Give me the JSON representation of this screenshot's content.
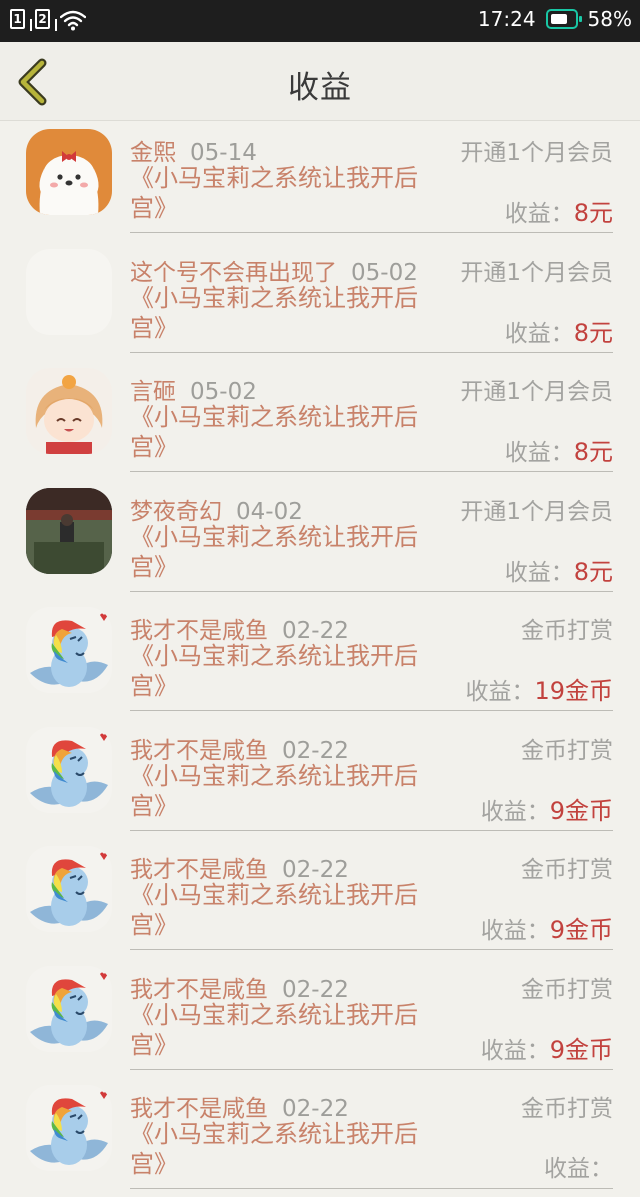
{
  "status_bar": {
    "sim1": "1",
    "sim2": "2",
    "time": "17:24",
    "battery": "58%",
    "battery_color": "#19c7a5"
  },
  "header": {
    "title": "收益",
    "back_icon": "chevron-left-icon"
  },
  "colors": {
    "accent_name": "#c8826a",
    "amount": "#c2423e",
    "muted": "#a3a3a0"
  },
  "items": [
    {
      "name": "金熙",
      "date": "05-14",
      "type": "开通1个月会员",
      "book": "《小马宝莉之系统让我开后宫》",
      "earn_label": "收益：",
      "amount": "8元",
      "avatar": "cartoon-dog"
    },
    {
      "name": "这个号不会再出现了",
      "date": "05-02",
      "type": "开通1个月会员",
      "book": "《小马宝莉之系统让我开后宫》",
      "earn_label": "收益：",
      "amount": "8元",
      "avatar": "blank"
    },
    {
      "name": "言砸",
      "date": "05-02",
      "type": "开通1个月会员",
      "book": "《小马宝莉之系统让我开后宫》",
      "earn_label": "收益：",
      "amount": "8元",
      "avatar": "anime-girl"
    },
    {
      "name": "梦夜奇幻",
      "date": "04-02",
      "type": "开通1个月会员",
      "book": "《小马宝莉之系统让我开后宫》",
      "earn_label": "收益：",
      "amount": "8元",
      "avatar": "photo"
    },
    {
      "name": "我才不是咸鱼",
      "date": "02-22",
      "type": "金币打赏",
      "book": "《小马宝莉之系统让我开后宫》",
      "earn_label": "收益：",
      "amount": "19金币",
      "avatar": "pony"
    },
    {
      "name": "我才不是咸鱼",
      "date": "02-22",
      "type": "金币打赏",
      "book": "《小马宝莉之系统让我开后宫》",
      "earn_label": "收益：",
      "amount": "9金币",
      "avatar": "pony"
    },
    {
      "name": "我才不是咸鱼",
      "date": "02-22",
      "type": "金币打赏",
      "book": "《小马宝莉之系统让我开后宫》",
      "earn_label": "收益：",
      "amount": "9金币",
      "avatar": "pony"
    },
    {
      "name": "我才不是咸鱼",
      "date": "02-22",
      "type": "金币打赏",
      "book": "《小马宝莉之系统让我开后宫》",
      "earn_label": "收益：",
      "amount": "9金币",
      "avatar": "pony"
    },
    {
      "name": "我才不是咸鱼",
      "date": "02-22",
      "type": "金币打赏",
      "book": "《小马宝莉之系统让我开后宫》",
      "earn_label": "收益：",
      "amount": "",
      "avatar": "pony"
    }
  ]
}
